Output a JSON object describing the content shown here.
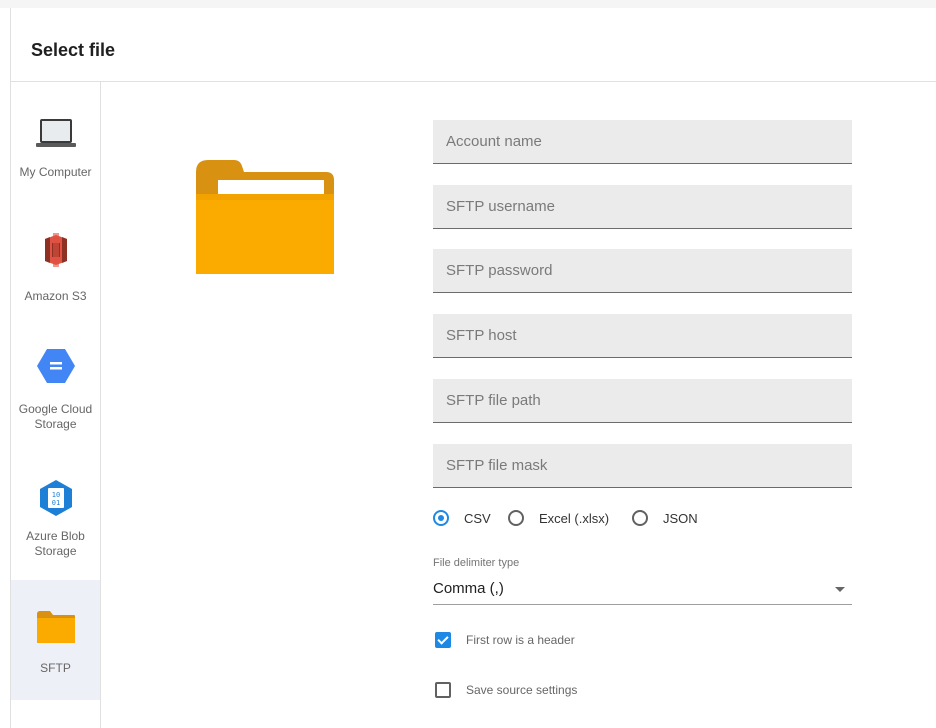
{
  "dialog": {
    "title": "Select file"
  },
  "sidebar": {
    "items": [
      {
        "label": "My Computer",
        "icon": "laptop-icon"
      },
      {
        "label": "Amazon S3",
        "icon": "amazon-s3-icon"
      },
      {
        "label": "Google Cloud Storage",
        "icon": "google-cloud-storage-icon"
      },
      {
        "label": "Azure Blob Storage",
        "icon": "azure-blob-storage-icon"
      },
      {
        "label": "SFTP",
        "icon": "folder-icon",
        "active": true
      }
    ]
  },
  "form": {
    "fields": [
      {
        "placeholder": "Account name",
        "value": ""
      },
      {
        "placeholder": "SFTP username",
        "value": ""
      },
      {
        "placeholder": "SFTP password",
        "value": ""
      },
      {
        "placeholder": "SFTP host",
        "value": ""
      },
      {
        "placeholder": "SFTP file path",
        "value": ""
      },
      {
        "placeholder": "SFTP file mask",
        "value": ""
      }
    ],
    "format_options": [
      {
        "label": "CSV",
        "selected": true
      },
      {
        "label": "Excel (.xlsx)",
        "selected": false
      },
      {
        "label": "JSON",
        "selected": false
      }
    ],
    "delimiter": {
      "label": "File delimiter type",
      "value": "Comma (,)"
    },
    "checkboxes": [
      {
        "label": "First row is a header",
        "checked": true
      },
      {
        "label": "Save source settings",
        "checked": false
      }
    ]
  },
  "colors": {
    "accent": "#1e88e5",
    "folder": "#fbab00",
    "folder_back": "#d99112",
    "sidebar_active_bg": "#eef0f8",
    "field_bg": "#ebebeb"
  }
}
